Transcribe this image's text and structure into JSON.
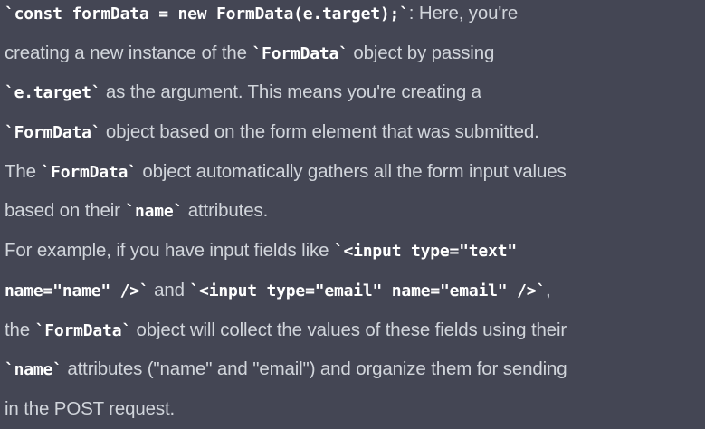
{
  "paragraph1": {
    "line1_code": "`const formData = new FormData(e.target);`",
    "line1_text": ": Here, you're",
    "line2_text_a": "creating a new instance of the ",
    "line2_code": "`FormData`",
    "line2_text_b": " object by passing",
    "line3_code": "`e.target`",
    "line3_text": " as the argument. This means you're creating a",
    "line4_code": "`FormData`",
    "line4_text": " object based on the form element that was submitted.",
    "line5_text_a": "The ",
    "line5_code": "`FormData`",
    "line5_text_b": " object automatically gathers all the form input values",
    "line6_text_a": "based on their ",
    "line6_code": "`name`",
    "line6_text_b": " attributes."
  },
  "paragraph2": {
    "line1_text": "For example, if you have input fields like ",
    "line1_code": "`<input type=\"text\"",
    "line2_code_a": "name=\"name\" />`",
    "line2_text": " and ",
    "line2_code_b": "`<input type=\"email\" name=\"email\" />`",
    "line2_text_b": ",",
    "line3_text_a": "the ",
    "line3_code": "`FormData`",
    "line3_text_b": " object will collect the values of these fields using their",
    "line4_code": "`name`",
    "line4_text": " attributes (\"name\" and \"email\") and organize them for sending",
    "line5_text": "in the POST request."
  }
}
